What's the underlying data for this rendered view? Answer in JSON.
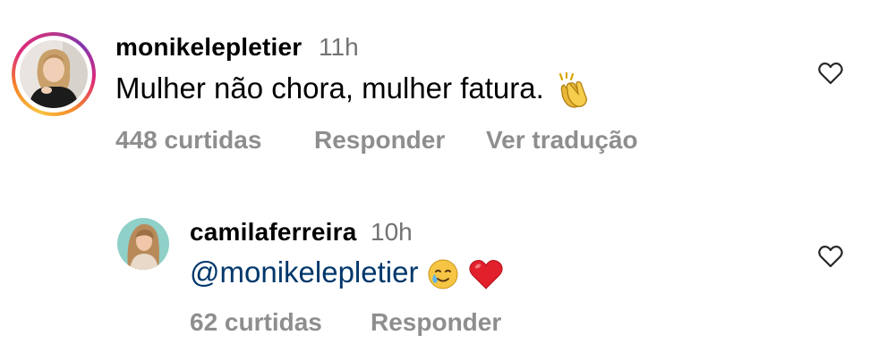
{
  "comments": [
    {
      "username": "monikelepletier",
      "time": "11h",
      "text": "Mulher não chora, mulher fatura.",
      "emoji": "clapping-hands-icon",
      "likes": "448 curtidas",
      "reply": "Responder",
      "translate": "Ver tradução"
    },
    {
      "username": "camilaferreira",
      "time": "10h",
      "mention": "@monikelepletier",
      "emojis": [
        "smiling-face-with-tear-icon",
        "red-heart-icon"
      ],
      "likes": "62 curtidas",
      "reply": "Responder"
    }
  ],
  "colors": {
    "mention": "#00376b",
    "meta": "#8e8e8e",
    "time": "#737373",
    "story_ring": [
      "#f9c440",
      "#f58529",
      "#dd2a7b",
      "#8134af"
    ]
  }
}
